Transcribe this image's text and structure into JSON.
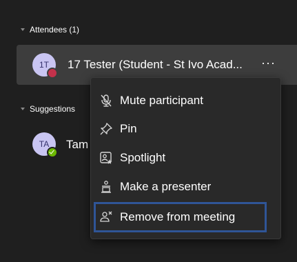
{
  "attendees_section": {
    "label": "Attendees (1)"
  },
  "attendee": {
    "initials": "1T",
    "name": "17 Tester (Student - St Ivo Acad...",
    "status": "busy",
    "more_label": "···"
  },
  "suggestions_section": {
    "label": "Suggestions"
  },
  "suggestion": {
    "initials": "TA",
    "name_visible": "Tam",
    "status": "available"
  },
  "context_menu": {
    "items": [
      {
        "label": "Mute participant",
        "icon": "mic-off-icon"
      },
      {
        "label": "Pin",
        "icon": "pin-icon"
      },
      {
        "label": "Spotlight",
        "icon": "spotlight-icon"
      },
      {
        "label": "Make a presenter",
        "icon": "presenter-icon"
      },
      {
        "label": "Remove from meeting",
        "icon": "remove-person-icon"
      }
    ]
  },
  "colors": {
    "background": "#1f1f1f",
    "row_hover": "#3d3d3d",
    "menu_background": "#292929",
    "highlight_border": "#2f5597",
    "busy": "#c4314b",
    "available": "#6bb700",
    "avatar_bg": "#c9c5f2"
  }
}
